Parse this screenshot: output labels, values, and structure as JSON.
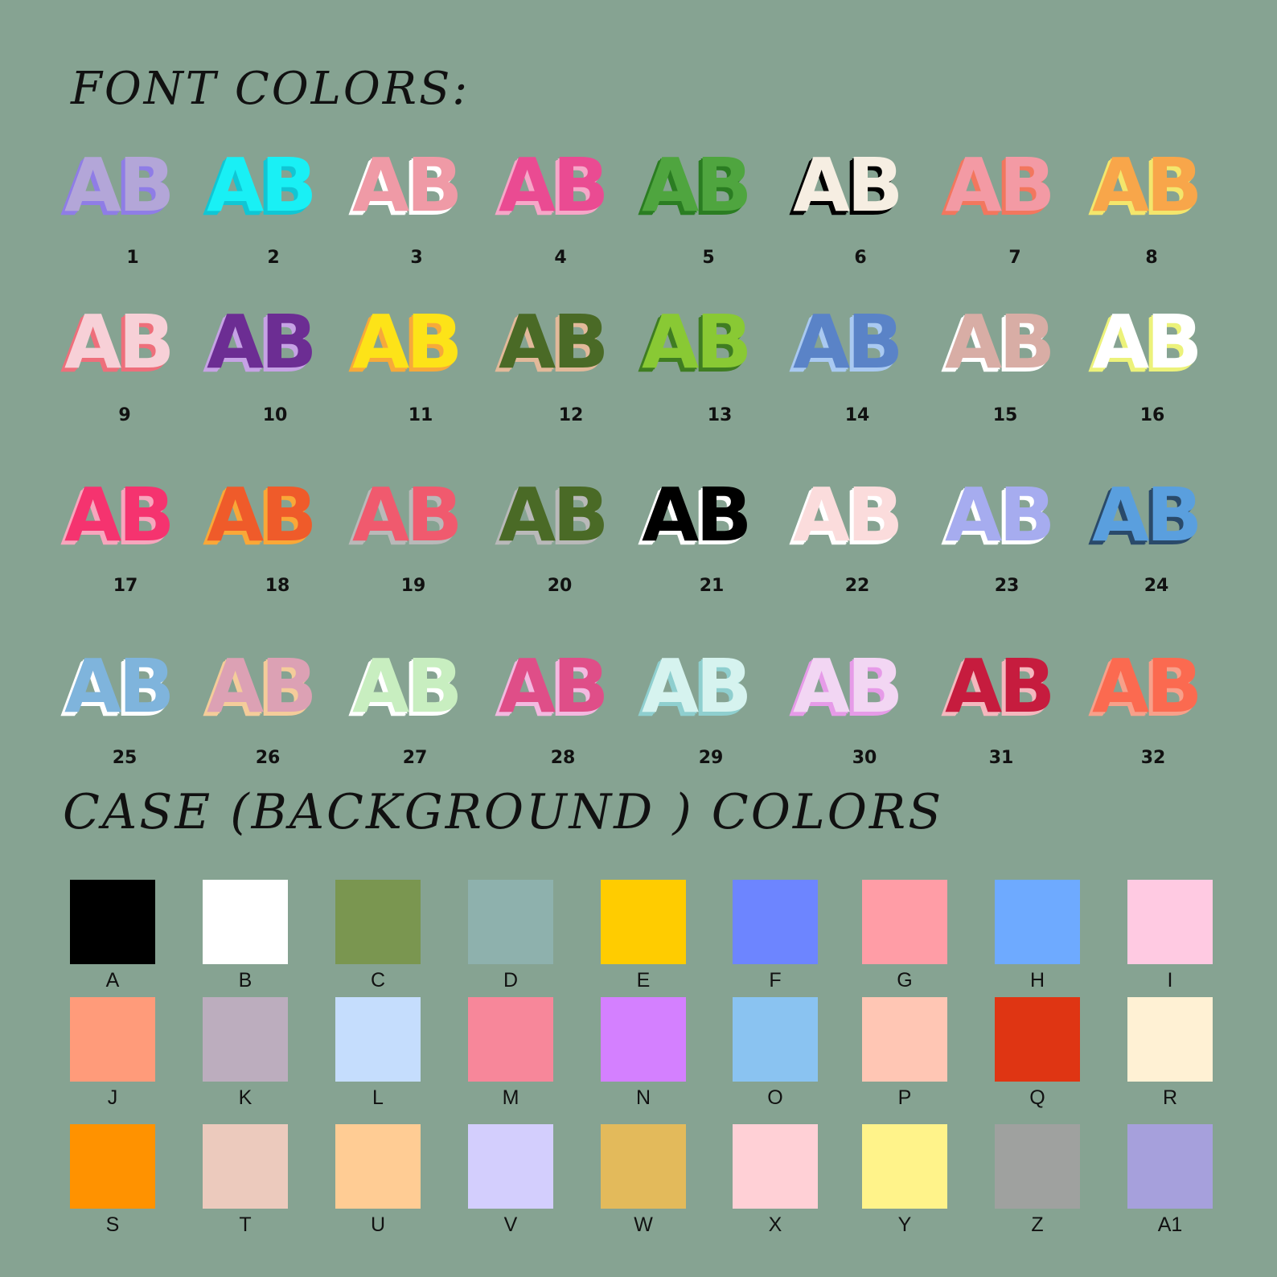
{
  "font_heading": "FONT COLORS:",
  "case_heading": "CASE (BACKGROUND ) COLORS",
  "font_colors": [
    {
      "label": "1",
      "text": "AB",
      "face": "#b3a6d8",
      "shadow": "#8f7de6"
    },
    {
      "label": "2",
      "text": "AB",
      "face": "#19f0f5",
      "shadow": "#11c6d4"
    },
    {
      "label": "3",
      "text": "AB",
      "face": "#ef9aa6",
      "shadow": "#ffffff"
    },
    {
      "label": "4",
      "text": "AB",
      "face": "#ea4b92",
      "shadow": "#f6a7c8"
    },
    {
      "label": "5",
      "text": "AB",
      "face": "#4fa53f",
      "shadow": "#2b7d22"
    },
    {
      "label": "6",
      "text": "AB",
      "face": "#f6eee2",
      "shadow": "#000000"
    },
    {
      "label": "7",
      "text": "AB",
      "face": "#f39aa4",
      "shadow": "#f2775e"
    },
    {
      "label": "8",
      "text": "AB",
      "face": "#f8a64a",
      "shadow": "#f3e66c"
    },
    {
      "label": "9",
      "text": "AB",
      "face": "#f7d0d7",
      "shadow": "#ee6f7b"
    },
    {
      "label": "10",
      "text": "AB",
      "face": "#6c2d93",
      "shadow": "#c6a2e5"
    },
    {
      "label": "11",
      "text": "AB",
      "face": "#fde318",
      "shadow": "#f7a93a"
    },
    {
      "label": "12",
      "text": "AB",
      "face": "#4a6a26",
      "shadow": "#e2b99a"
    },
    {
      "label": "13",
      "text": "AB",
      "face": "#89c934",
      "shadow": "#3f7d22"
    },
    {
      "label": "14",
      "text": "AB",
      "face": "#5a83c7",
      "shadow": "#a9c9f1"
    },
    {
      "label": "15",
      "text": "AB",
      "face": "#d8ada5",
      "shadow": "#ffffff"
    },
    {
      "label": "16",
      "text": "AB",
      "face": "#ffffff",
      "shadow": "#ecf27a"
    },
    {
      "label": "17",
      "text": "AB",
      "face": "#f5336f",
      "shadow": "#f7a6bd"
    },
    {
      "label": "18",
      "text": "AB",
      "face": "#ef5b2a",
      "shadow": "#f9a838"
    },
    {
      "label": "19",
      "text": "AB",
      "face": "#f05a6e",
      "shadow": "#b9b9b9"
    },
    {
      "label": "20",
      "text": "AB",
      "face": "#4a6a26",
      "shadow": "#b9b9b9"
    },
    {
      "label": "21",
      "text": "AB",
      "face": "#000000",
      "shadow": "#ffffff"
    },
    {
      "label": "22",
      "text": "AB",
      "face": "#fbdcdc",
      "shadow": "#ffffff"
    },
    {
      "label": "23",
      "text": "AB",
      "face": "#a6acef",
      "shadow": "#ffffff"
    },
    {
      "label": "24",
      "text": "AB",
      "face": "#5a9fde",
      "shadow": "#2a4a6a"
    },
    {
      "label": "25",
      "text": "AB",
      "face": "#7fb4dc",
      "shadow": "#ffffff"
    },
    {
      "label": "26",
      "text": "AB",
      "face": "#dca1b4",
      "shadow": "#f4cc9a"
    },
    {
      "label": "27",
      "text": "AB",
      "face": "#c8eec0",
      "shadow": "#ffffff"
    },
    {
      "label": "28",
      "text": "AB",
      "face": "#df4e88",
      "shadow": "#f3b9e0"
    },
    {
      "label": "29",
      "text": "AB",
      "face": "#d6f3ef",
      "shadow": "#8fcfcf"
    },
    {
      "label": "30",
      "text": "AB",
      "face": "#f2d6f3",
      "shadow": "#e69be8"
    },
    {
      "label": "31",
      "text": "AB",
      "face": "#c61c3e",
      "shadow": "#f4b8be"
    },
    {
      "label": "32",
      "text": "AB",
      "face": "#fb6a50",
      "shadow": "#f7a08a"
    }
  ],
  "case_colors": [
    {
      "label": "A",
      "color": "#000000"
    },
    {
      "label": "B",
      "color": "#ffffff"
    },
    {
      "label": "C",
      "color": "#7a9650"
    },
    {
      "label": "D",
      "color": "#8eb1ad"
    },
    {
      "label": "E",
      "color": "#ffcc00"
    },
    {
      "label": "F",
      "color": "#6d85ff"
    },
    {
      "label": "G",
      "color": "#ff9da6"
    },
    {
      "label": "H",
      "color": "#6eaaff"
    },
    {
      "label": "I",
      "color": "#ffcae2"
    },
    {
      "label": "J",
      "color": "#ff9b7a"
    },
    {
      "label": "K",
      "color": "#bcadbe"
    },
    {
      "label": "L",
      "color": "#c5ddfd"
    },
    {
      "label": "M",
      "color": "#f7879a"
    },
    {
      "label": "N",
      "color": "#d480ff"
    },
    {
      "label": "O",
      "color": "#8ac3f1"
    },
    {
      "label": "P",
      "color": "#ffc6b4"
    },
    {
      "label": "Q",
      "color": "#df3513"
    },
    {
      "label": "R",
      "color": "#fff1d4"
    },
    {
      "label": "S",
      "color": "#ff9200"
    },
    {
      "label": "T",
      "color": "#eccabd"
    },
    {
      "label": "U",
      "color": "#ffcc94"
    },
    {
      "label": "V",
      "color": "#d3cefd"
    },
    {
      "label": "W",
      "color": "#e3ba5b"
    },
    {
      "label": "X",
      "color": "#ffd0d6"
    },
    {
      "label": "Y",
      "color": "#fff38a"
    },
    {
      "label": "Z",
      "color": "#9fa19f"
    },
    {
      "label": "A1",
      "color": "#a6a0dc"
    }
  ]
}
